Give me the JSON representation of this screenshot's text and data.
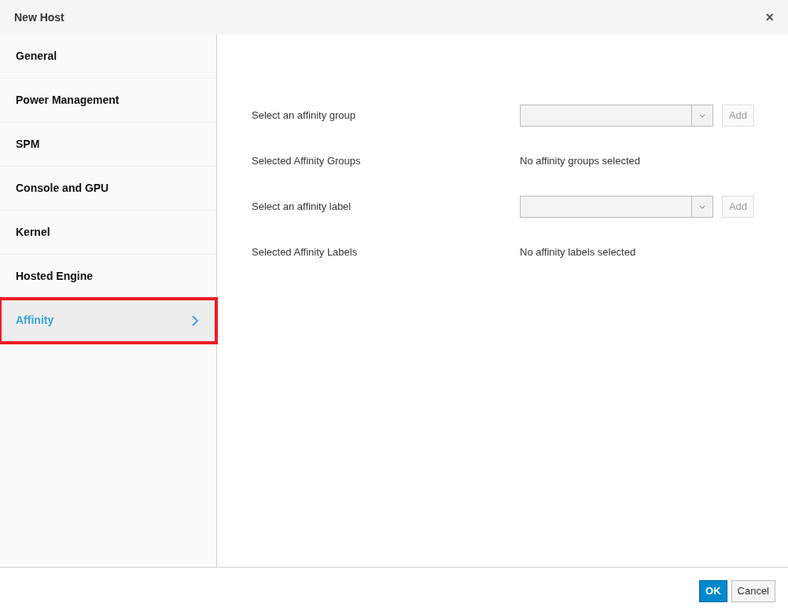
{
  "window": {
    "title": "New Host",
    "close": "×"
  },
  "sidebar": {
    "items": [
      {
        "label": "General",
        "selected": false,
        "highlighted": false
      },
      {
        "label": "Power Management",
        "selected": false,
        "highlighted": false
      },
      {
        "label": "SPM",
        "selected": false,
        "highlighted": false
      },
      {
        "label": "Console and GPU",
        "selected": false,
        "highlighted": false
      },
      {
        "label": "Kernel",
        "selected": false,
        "highlighted": false
      },
      {
        "label": "Hosted Engine",
        "selected": false,
        "highlighted": false
      },
      {
        "label": "Affinity",
        "selected": true,
        "highlighted": true
      }
    ]
  },
  "form": {
    "rows": [
      {
        "kind": "select",
        "label": "Select an affinity group",
        "button": "Add"
      },
      {
        "kind": "text",
        "label": "Selected Affinity Groups",
        "value": "No affinity groups selected"
      },
      {
        "kind": "select",
        "label": "Select an affinity label",
        "button": "Add"
      },
      {
        "kind": "text",
        "label": "Selected Affinity Labels",
        "value": "No affinity labels selected"
      }
    ]
  },
  "buttons": [
    {
      "label": "OK",
      "kind": "primary"
    },
    {
      "label": "Cancel",
      "kind": "default"
    }
  ]
}
